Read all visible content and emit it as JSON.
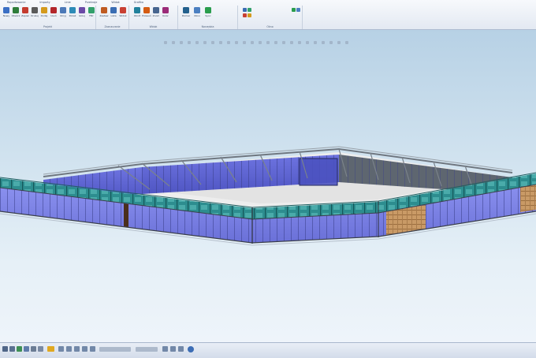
{
  "ribbon": {
    "tabs": [
      "Raportowanie",
      "Importy",
      "Linie",
      "Przekroje",
      "Widok",
      "Grafika"
    ],
    "groups": [
      {
        "label": "Projekt"
      },
      {
        "label": "Zaznaczanie"
      },
      {
        "label": "Widok"
      },
      {
        "label": "Narzędzia"
      },
      {
        "label": "Okno"
      }
    ],
    "buttons": [
      {
        "label": "Nowy",
        "color": "#3b6fc4"
      },
      {
        "label": "Otwórz",
        "color": "#2f7d3a"
      },
      {
        "label": "Zapisz",
        "color": "#c43b2f"
      },
      {
        "label": "Drukuj",
        "color": "#5a5a5a"
      },
      {
        "label": "Dodaj",
        "color": "#d49a1e"
      },
      {
        "label": "Usuń",
        "color": "#b3262b"
      },
      {
        "label": "Ukryj",
        "color": "#4c79b8"
      },
      {
        "label": "Pokaż",
        "color": "#2d8bb7"
      },
      {
        "label": "Izoluj",
        "color": "#6b4aa7"
      },
      {
        "label": "Filtr",
        "color": "#33a06b"
      },
      {
        "label": "Zestaw",
        "color": "#bf5b21"
      },
      {
        "label": "Lista",
        "color": "#3a6db3"
      },
      {
        "label": "Widok",
        "color": "#c94033"
      },
      {
        "label": "Obrót",
        "color": "#22819c"
      },
      {
        "label": "Przesuń",
        "color": "#d45b12"
      },
      {
        "label": "Zoom",
        "color": "#47658f"
      },
      {
        "label": "Kolor",
        "color": "#9b2b78"
      },
      {
        "label": "Pomiar",
        "color": "#23608d"
      },
      {
        "label": "Okno",
        "color": "#4b7fc1"
      },
      {
        "label": "Sync",
        "color": "#2a9d4d"
      }
    ]
  },
  "viewport": {
    "background_top": "#b7d1e5",
    "background_bottom": "#eef4fa",
    "model": {
      "glass_color": "#7b82e6",
      "frame_color": "#58606a",
      "band_color": "#2d8d8f",
      "floor_color": "#eeeeee",
      "timber_color": "#c99a66"
    }
  },
  "statusbar": {
    "icons": [
      "select-icon",
      "play-icon",
      "zoom-icon",
      "pan-icon",
      "camera-icon",
      "settings-icon"
    ]
  }
}
